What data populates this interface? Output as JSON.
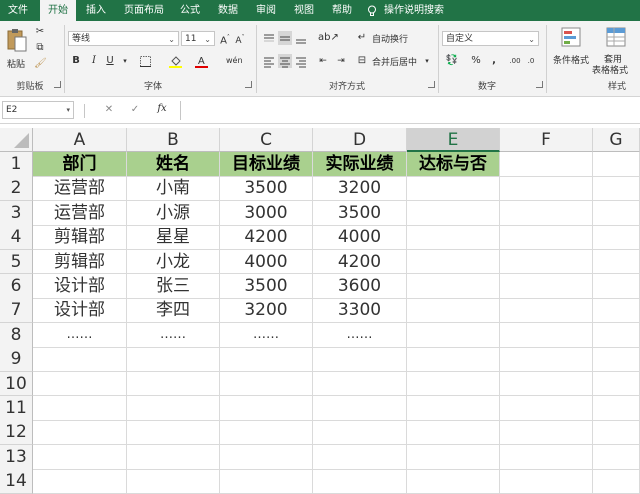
{
  "tabs": [
    {
      "label": "文件",
      "active": false
    },
    {
      "label": "开始",
      "active": true
    },
    {
      "label": "插入",
      "active": false
    },
    {
      "label": "页面布局",
      "active": false
    },
    {
      "label": "公式",
      "active": false
    },
    {
      "label": "数据",
      "active": false
    },
    {
      "label": "审阅",
      "active": false
    },
    {
      "label": "视图",
      "active": false
    },
    {
      "label": "帮助",
      "active": false
    }
  ],
  "tell_me": "操作说明搜索",
  "ribbon": {
    "clipboard": {
      "group": "剪贴板",
      "paste": "粘贴"
    },
    "font": {
      "group": "字体",
      "name": "等线",
      "size": "11",
      "bold": "B",
      "italic": "I",
      "underline": "U"
    },
    "alignment": {
      "group": "对齐方式",
      "wrap": "自动换行",
      "merge": "合并后居中"
    },
    "number": {
      "group": "数字",
      "format": "自定义",
      "percent": "%",
      "comma": ","
    },
    "styles": {
      "group": "样式",
      "conditional": "条件格式",
      "table": "套用\n表格格式"
    }
  },
  "formula_bar": {
    "name_box": "E2",
    "fx": "fx",
    "cancel": "✕",
    "enter": "✓"
  },
  "columns": [
    "A",
    "B",
    "C",
    "D",
    "E",
    "F",
    "G"
  ],
  "selected_column": "E",
  "rows": [
    "1",
    "2",
    "3",
    "4",
    "5",
    "6",
    "7",
    "8",
    "9",
    "10",
    "11",
    "12",
    "13",
    "14"
  ],
  "header_row": [
    "部门",
    "姓名",
    "目标业绩",
    "实际业绩",
    "达标与否"
  ],
  "data_rows": [
    [
      "运营部",
      "小南",
      "3500",
      "3200",
      ""
    ],
    [
      "运营部",
      "小源",
      "3000",
      "3500",
      ""
    ],
    [
      "剪辑部",
      "星星",
      "4200",
      "4000",
      ""
    ],
    [
      "剪辑部",
      "小龙",
      "4000",
      "4200",
      ""
    ],
    [
      "设计部",
      "张三",
      "3500",
      "3600",
      ""
    ],
    [
      "设计部",
      "李四",
      "3200",
      "3300",
      ""
    ],
    [
      "……",
      "……",
      "……",
      "……",
      ""
    ]
  ],
  "colors": {
    "accent": "#217346",
    "header_fill": "#a9d08e"
  }
}
